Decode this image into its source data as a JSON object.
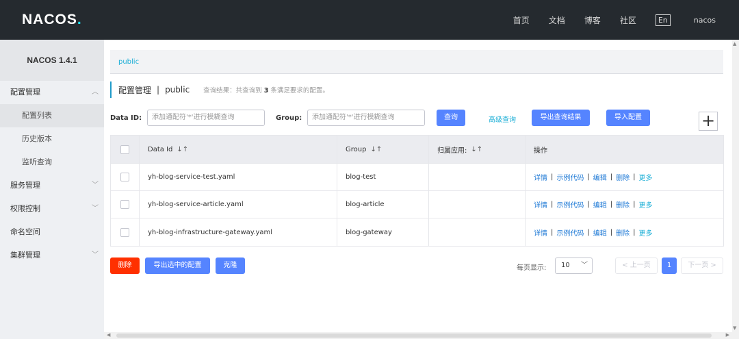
{
  "topbar": {
    "logo_main": "NACOS",
    "logo_dot": ".",
    "nav": [
      "首页",
      "文档",
      "博客",
      "社区"
    ],
    "lang": "En",
    "user": "nacos"
  },
  "sidebar": {
    "title": "NACOS 1.4.1",
    "groups": [
      {
        "label": "配置管理",
        "arrow": "^"
      },
      {
        "label": "服务管理",
        "arrow": "v"
      },
      {
        "label": "权限控制",
        "arrow": "v"
      },
      {
        "label": "命名空间",
        "arrow": ""
      },
      {
        "label": "集群管理",
        "arrow": "v"
      }
    ],
    "config_items": [
      "配置列表",
      "历史版本",
      "监听查询"
    ]
  },
  "breadcrumb": "public",
  "title": {
    "main": "配置管理",
    "sep": "|",
    "namespace": "public",
    "hint_prefix": "查询结果：共查询到",
    "hint_count": "3",
    "hint_suffix": "条满足要求的配置。"
  },
  "filter": {
    "dataid_label": "Data ID:",
    "dataid_placeholder": "添加通配符'*'进行模糊查询",
    "group_label": "Group:",
    "group_placeholder": "添加通配符'*'进行模糊查询",
    "query": "查询",
    "advanced": "高级查询",
    "export_results": "导出查询结果",
    "import": "导入配置",
    "plus": "+"
  },
  "table": {
    "headers": [
      "Data Id",
      "Group",
      "归属应用:",
      "操作"
    ],
    "sort_icon": "↓↑",
    "rows": [
      {
        "data_id": "yh-blog-service-test.yaml",
        "group": "blog-test",
        "app": ""
      },
      {
        "data_id": "yh-blog-service-article.yaml",
        "group": "blog-article",
        "app": ""
      },
      {
        "data_id": "yh-blog-infrastructure-gateway.yaml",
        "group": "blog-gateway",
        "app": ""
      }
    ],
    "ops": [
      "详情",
      "示例代码",
      "编辑",
      "删除",
      "更多"
    ],
    "ops_sep": "|"
  },
  "bottom": {
    "delete": "删除",
    "export_selected": "导出选中的配置",
    "clone": "克隆",
    "page_size_label": "每页显示:",
    "page_size": "10",
    "prev": "< 上一页",
    "current_page": "1",
    "next": "下一页 >"
  },
  "colors": {
    "topbar_bg": "#252a2f",
    "primary": "#5584ff",
    "danger": "#ff3000",
    "link": "#1aaed6"
  }
}
